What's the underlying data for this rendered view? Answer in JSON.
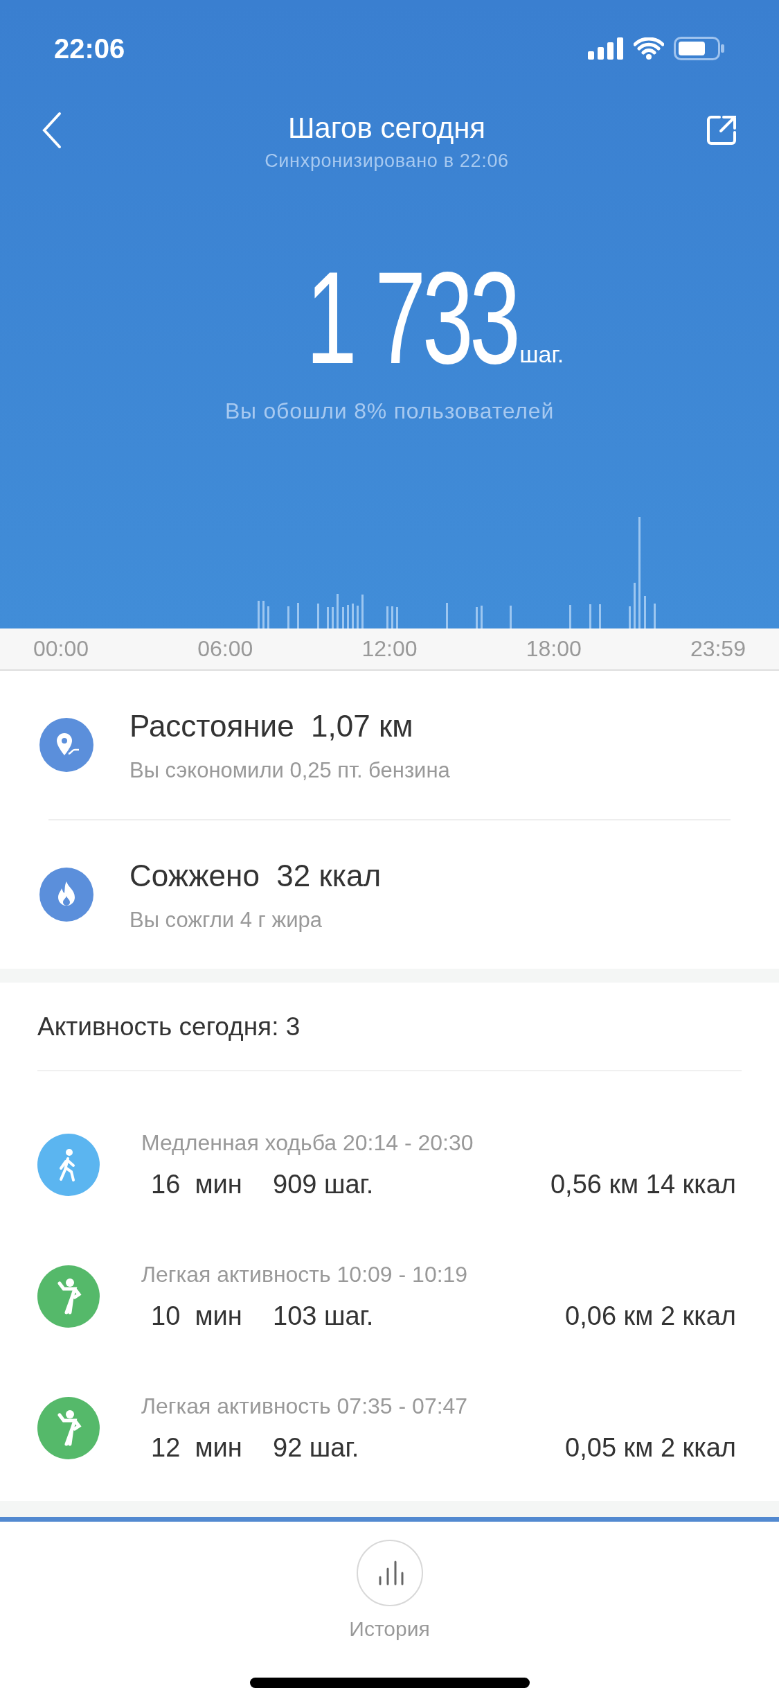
{
  "status_bar": {
    "time": "22:06"
  },
  "header": {
    "title": "Шагов сегодня",
    "subtitle": "Синхронизировано в 22:06"
  },
  "summary": {
    "steps": "1 733",
    "unit": "шаг.",
    "comparison": "Вы обошли 8% пользователей"
  },
  "step_chart": {
    "axis_labels": [
      "00:00",
      "06:00",
      "12:00",
      "18:00",
      "23:59"
    ]
  },
  "stats": [
    {
      "kind": "distance",
      "label": "Расстояние",
      "value": "1,07 км",
      "note": "Вы сэкономили 0,25 пт. бензина"
    },
    {
      "kind": "calories",
      "label": "Сожжено",
      "value": "32 ккал",
      "note": "Вы сожгли 4 г жира"
    }
  ],
  "activities": {
    "heading": "Активность сегодня: 3",
    "items": [
      {
        "kind": "walk",
        "color": "#5bb5f0",
        "title": "Медленная ходьба 20:14 - 20:30",
        "duration": "16  мин",
        "steps": "909",
        "steps_unit": "шаг.",
        "distance": "0,56 км",
        "calories": "14 ккал"
      },
      {
        "kind": "light",
        "color": "#55b96a",
        "title": "Легкая активность 10:09 - 10:19",
        "duration": "10  мин",
        "steps": "103",
        "steps_unit": "шаг.",
        "distance": "0,06 км",
        "calories": "2 ккал"
      },
      {
        "kind": "light",
        "color": "#55b96a",
        "title": "Легкая активность 07:35 - 07:47",
        "duration": "12  мин",
        "steps": "92",
        "steps_unit": "шаг.",
        "distance": "0,05 км",
        "calories": "2 ккал"
      }
    ]
  },
  "bottom_bar": {
    "history_label": "История"
  }
}
